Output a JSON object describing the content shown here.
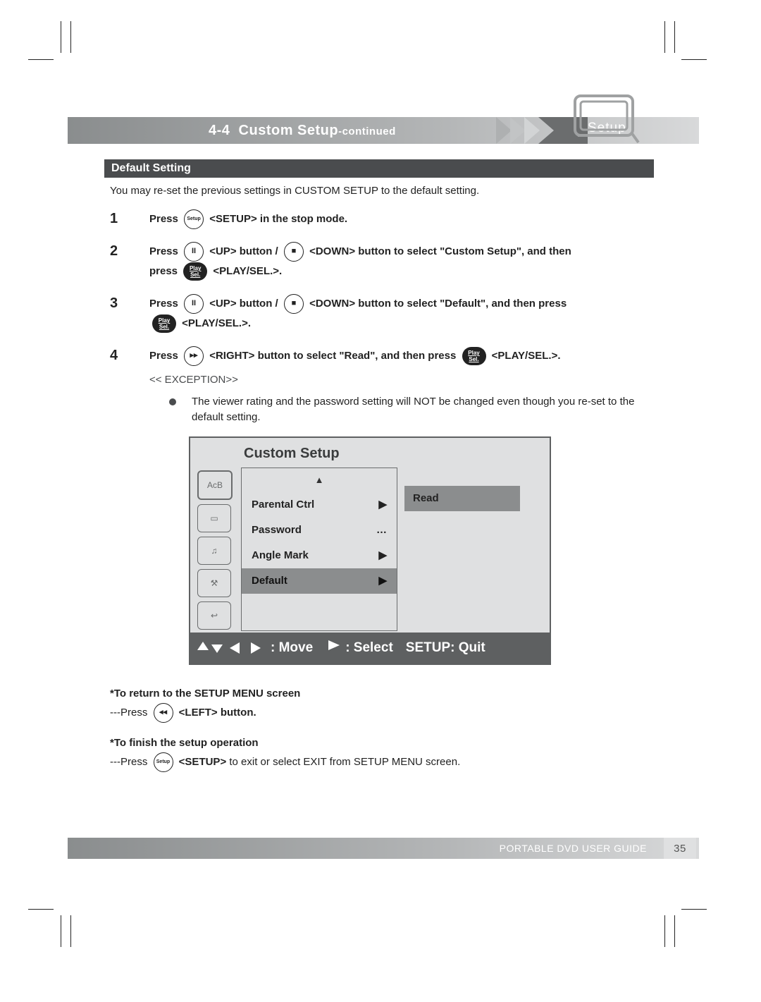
{
  "header": {
    "section_number": "4-4",
    "section_title": "Custom Setup",
    "continued": "-continued",
    "chapter_tab": "Setup"
  },
  "subheader": "Default Setting",
  "intro": "You may re-set the previous settings in CUSTOM SETUP to the default setting.",
  "steps": [
    {
      "num": "1",
      "parts": {
        "press": "Press",
        "setup_badge": "Setup",
        "after": " <SETUP> in the stop mode."
      }
    },
    {
      "num": "2",
      "parts": {
        "press": "Press",
        "up": " <UP> button / ",
        "down": " <DOWN> button to select \"Custom Setup\", and then",
        "press2": "press",
        "playsel_top": "Play",
        "playsel_bot": "Sel.",
        "playsel": " <PLAY/SEL.>."
      }
    },
    {
      "num": "3",
      "parts": {
        "press": "Press",
        "up": " <UP> button / ",
        "down": " <DOWN> button to select \"Default\", and then press",
        "playsel_top": "Play",
        "playsel_bot": "Sel.",
        "playsel": " <PLAY/SEL.>."
      }
    },
    {
      "num": "4",
      "parts": {
        "press": "Press",
        "right": " <RIGHT> button to select \"Read\", and then press ",
        "playsel_top": "Play",
        "playsel_bot": "Sel.",
        "playsel": " <PLAY/SEL.>."
      },
      "exception_label": "<< EXCEPTION>>",
      "exception_body": "The viewer rating and the password setting will NOT be changed even though you re-set to the default setting."
    }
  ],
  "osd": {
    "title": "Custom Setup",
    "left_tabs": [
      "AcB",
      "▭",
      "♫",
      "⚒",
      "↩"
    ],
    "menu": [
      {
        "label": "Parental Ctrl",
        "mark": "▶"
      },
      {
        "label": "Password",
        "mark": "…"
      },
      {
        "label": "Angle Mark",
        "mark": "▶"
      },
      {
        "label": "Default",
        "mark": "▶",
        "selected": true
      }
    ],
    "right_value": "Read",
    "footer": {
      "move": ": Move",
      "select": ": Select",
      "quit": "SETUP: Quit"
    }
  },
  "notes": {
    "return_header": "*To return to the SETUP MENU screen",
    "return_body_pre": "---Press ",
    "return_body_post": " <LEFT> button.",
    "finish_header": "*To finish the setup operation",
    "finish_body_pre": "---Press ",
    "finish_badge": "Setup",
    "finish_body_mid": " <SETUP>",
    "finish_body_post": " to exit or select EXIT from SETUP MENU screen."
  },
  "footer": {
    "label": "PORTABLE DVD USER GUIDE",
    "page": "35"
  },
  "icons": {
    "pause": "II",
    "stop": "■",
    "fwd": "▸▸",
    "back": "◂◂"
  }
}
